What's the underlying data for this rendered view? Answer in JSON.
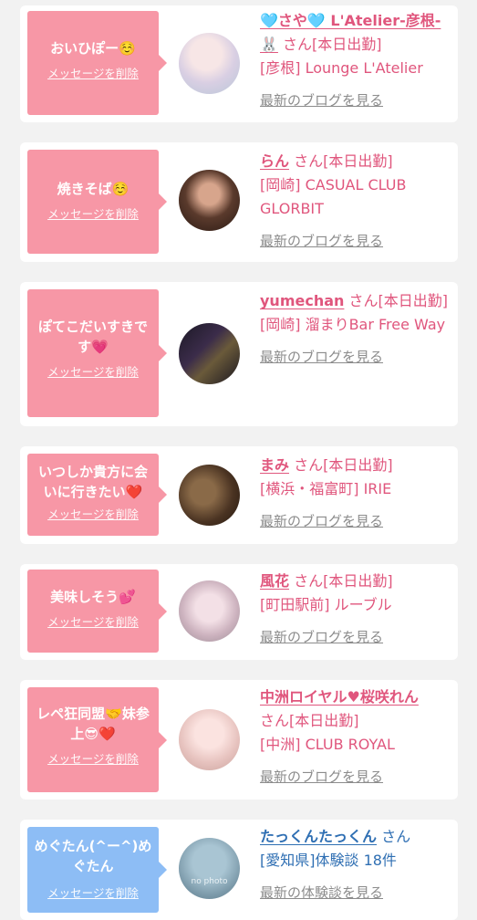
{
  "cards": [
    {
      "message": "おいひぽー☺️",
      "delete_label": "メッセージを削除",
      "name": "🩵さや🩵 L'Atelier-彦根-🐰",
      "suffix": "さん[本日出勤]",
      "shop": "[彦根] Lounge L'Atelier",
      "link": "最新のブログを見る"
    },
    {
      "message": "焼きそば☺️",
      "delete_label": "メッセージを削除",
      "name": "らん",
      "suffix": "さん[本日出勤]",
      "shop": "[岡崎] CASUAL CLUB GLORBIT",
      "link": "最新のブログを見る"
    },
    {
      "message": "ぽてこだいすきです💗",
      "delete_label": "メッセージを削除",
      "name": "yumechan",
      "suffix": "さん[本日出勤]",
      "shop": "[岡崎] 溜まりBar Free Way",
      "link": "最新のブログを見る"
    },
    {
      "message": "いつしか貴方に会いに行きたい❤️",
      "delete_label": "メッセージを削除",
      "name": "まみ",
      "suffix": "さん[本日出勤]",
      "shop": "[横浜・福富町] IRIE",
      "link": "最新のブログを見る"
    },
    {
      "message": "美味しそう💕",
      "delete_label": "メッセージを削除",
      "name": "風花",
      "suffix": "さん[本日出勤]",
      "shop": "[町田駅前] ルーブル",
      "link": "最新のブログを見る"
    },
    {
      "message": "レペ狂同盟🤝妹参上😎❤️",
      "delete_label": "メッセージを削除",
      "name": "中洲ロイヤル♥桜咲れん",
      "suffix": "さん[本日出勤]",
      "shop": "[中洲] CLUB ROYAL",
      "link": "最新のブログを見る"
    },
    {
      "message": "めぐたん(^ー^)めぐたん",
      "delete_label": "メッセージを削除",
      "name": "たっくんたっくん",
      "suffix": "さん",
      "shop": "[愛知県]体験談 18件",
      "link": "最新の体験談を見る",
      "avatar_text": "no photo"
    }
  ],
  "colors": {
    "pink_bubble": "#f797a6",
    "blue_bubble": "#8dbdf5",
    "pink_text": "#e0567d",
    "blue_text": "#2f6fb3",
    "link_gray": "#8c8c8c"
  }
}
